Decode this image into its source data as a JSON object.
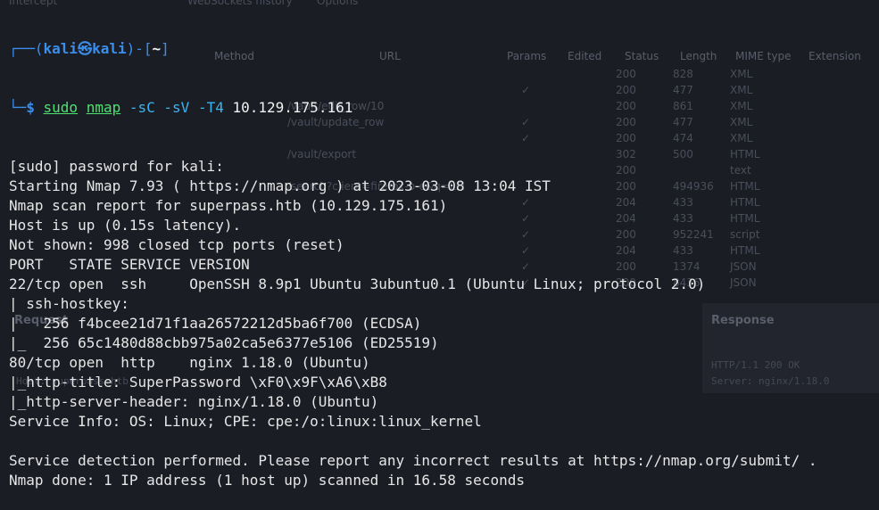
{
  "background_app": {
    "tabs": [
      "Intercept",
      "WebSockets history",
      "Options"
    ],
    "columns": [
      "Method",
      "URL",
      "Params",
      "Edited",
      "Status",
      "Length",
      "MIME type",
      "Extension"
    ],
    "rows": [
      {
        "url": "",
        "params": "",
        "status": "200",
        "length": "828",
        "mime": "XML"
      },
      {
        "url": "",
        "params": "✓",
        "status": "200",
        "length": "477",
        "mime": "XML"
      },
      {
        "url": "/vault/edit_row/10",
        "params": "",
        "status": "200",
        "length": "861",
        "mime": "XML"
      },
      {
        "url": "/vault/update_row",
        "params": "✓",
        "status": "200",
        "length": "477",
        "mime": "XML"
      },
      {
        "url": "",
        "params": "✓",
        "status": "200",
        "length": "474",
        "mime": "XML"
      },
      {
        "url": "/vault/export",
        "params": "",
        "status": "302",
        "length": "500",
        "mime": "HTML"
      },
      {
        "url": "",
        "params": "",
        "status": "200",
        "length": "",
        "mime": "text"
      },
      {
        "url": "/search?client=firefox-b-e&q=LFI",
        "params": "",
        "status": "200",
        "length": "494936",
        "mime": "HTML"
      },
      {
        "url": "",
        "params": "✓",
        "status": "204",
        "length": "433",
        "mime": "HTML"
      },
      {
        "url": "",
        "params": "✓",
        "status": "204",
        "length": "433",
        "mime": "HTML"
      },
      {
        "url": "",
        "params": "✓",
        "status": "200",
        "length": "952241",
        "mime": "script"
      },
      {
        "url": "",
        "params": "✓",
        "status": "204",
        "length": "433",
        "mime": "HTML"
      },
      {
        "url": "",
        "params": "✓",
        "status": "200",
        "length": "1374",
        "mime": "JSON"
      },
      {
        "url": "",
        "params": "✓",
        "status": "200",
        "length": "8436",
        "mime": "JSON"
      }
    ],
    "request_label": "Request",
    "response_label": "Response",
    "request_host": "Host: superpass.htb",
    "response_lines": [
      "HTTP/1.1 200 OK",
      "Server: nginx/1.18.0"
    ]
  },
  "prompt": {
    "user": "kali",
    "host": "kali",
    "dir": "~",
    "sudo": "sudo",
    "command": "nmap",
    "args": "-sC -sV -T4",
    "target": "10.129.175.161"
  },
  "output": [
    "[sudo] password for kali:",
    "Starting Nmap 7.93 ( https://nmap.org ) at 2023-03-08 13:04 IST",
    "Nmap scan report for superpass.htb (10.129.175.161)",
    "Host is up (0.15s latency).",
    "Not shown: 998 closed tcp ports (reset)",
    "PORT   STATE SERVICE VERSION",
    "22/tcp open  ssh     OpenSSH 8.9p1 Ubuntu 3ubuntu0.1 (Ubuntu Linux; protocol 2.0)",
    "| ssh-hostkey: ",
    "|   256 f4bcee21d71f1aa26572212d5ba6f700 (ECDSA)",
    "|_  256 65c1480d88cbb975a02ca5e6377e5106 (ED25519)",
    "80/tcp open  http    nginx 1.18.0 (Ubuntu)",
    "|_http-title: SuperPassword \\xF0\\x9F\\xA6\\xB8",
    "|_http-server-header: nginx/1.18.0 (Ubuntu)",
    "Service Info: OS: Linux; CPE: cpe:/o:linux:linux_kernel",
    "",
    "Service detection performed. Please report any incorrect results at https://nmap.org/submit/ .",
    "Nmap done: 1 IP address (1 host up) scanned in 16.58 seconds"
  ],
  "colors": {
    "prompt_frame": "#3b8eea",
    "command": "#4ee26f",
    "text": "#e6e6e6",
    "background": "#1b1d25"
  }
}
